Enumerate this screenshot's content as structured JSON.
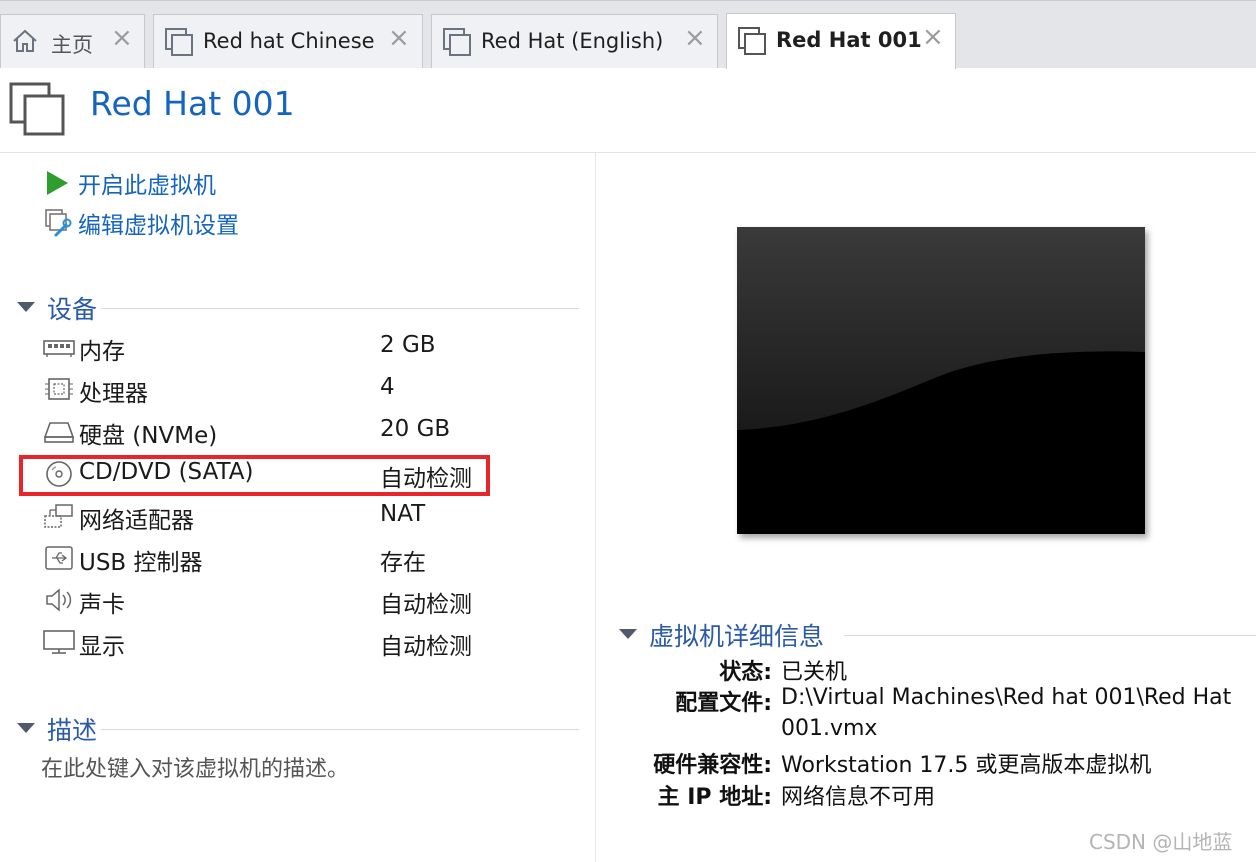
{
  "tabs": [
    {
      "label": "主页",
      "icon": "home-icon"
    },
    {
      "label": "Red hat Chinese",
      "icon": "vm-icon"
    },
    {
      "label": "Red Hat (English)",
      "icon": "vm-icon"
    },
    {
      "label": "Red Hat 001",
      "icon": "vm-icon",
      "active": true
    }
  ],
  "tab_close_glyph": "×",
  "vm_title": "Red Hat 001",
  "actions": {
    "power_on": "开启此虚拟机",
    "edit_settings": "编辑虚拟机设置"
  },
  "devices_section": {
    "title": "设备",
    "items": [
      {
        "name": "内存",
        "value": "2 GB",
        "icon": "memory-icon"
      },
      {
        "name": "处理器",
        "value": "4",
        "icon": "processor-icon"
      },
      {
        "name": "硬盘 (NVMe)",
        "value": "20 GB",
        "icon": "harddisk-icon"
      },
      {
        "name": "CD/DVD (SATA)",
        "value": "自动检测",
        "icon": "cd-dvd-icon"
      },
      {
        "name": "网络适配器",
        "value": "NAT",
        "icon": "network-adapter-icon"
      },
      {
        "name": "USB 控制器",
        "value": "存在",
        "icon": "usb-icon"
      },
      {
        "name": "声卡",
        "value": "自动检测",
        "icon": "speaker-icon"
      },
      {
        "name": "显示",
        "value": "自动检测",
        "icon": "monitor-icon"
      }
    ]
  },
  "description_section": {
    "title": "描述",
    "placeholder": "在此处键入对该虚拟机的描述。"
  },
  "details_section": {
    "title": "虚拟机详细信息",
    "status_label": "状态:",
    "status_value": "已关机",
    "config_label": "配置文件:",
    "config_value_line1": "D:\\Virtual Machines\\Red hat 001\\Red Hat",
    "config_value_line2": "001.vmx",
    "compat_label": "硬件兼容性:",
    "compat_value": "Workstation 17.5 或更高版本虚拟机",
    "ip_label": "主 IP 地址:",
    "ip_value": "网络信息不可用"
  },
  "colors": {
    "accent": "#1565c0",
    "highlight_border": "#e8262a",
    "play_green": "#2e9e2e"
  },
  "watermark": "CSDN @山地蓝"
}
